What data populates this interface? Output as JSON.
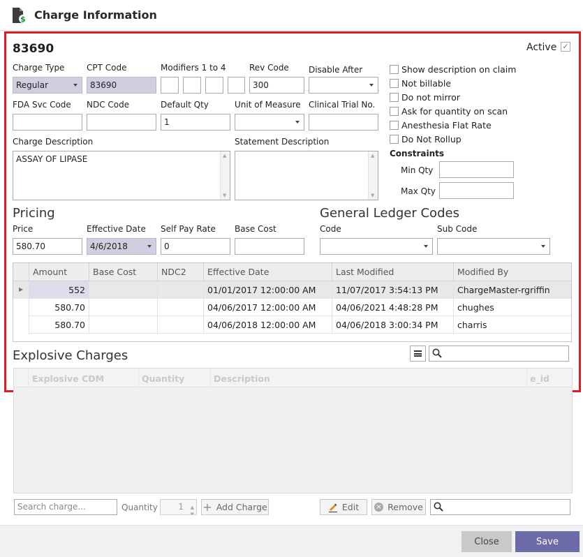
{
  "window": {
    "title": "Charge Information"
  },
  "header": {
    "code": "83690",
    "active_label": "Active"
  },
  "fields": {
    "charge_type": {
      "label": "Charge Type",
      "value": "Regular"
    },
    "cpt_code": {
      "label": "CPT Code",
      "value": "83690"
    },
    "modifiers": {
      "label": "Modifiers 1 to 4"
    },
    "rev_code": {
      "label": "Rev Code",
      "value": "300"
    },
    "disable_after": {
      "label": "Disable After",
      "value": ""
    },
    "fda_svc_code": {
      "label": "FDA Svc Code",
      "value": ""
    },
    "ndc_code": {
      "label": "NDC Code",
      "value": ""
    },
    "default_qty": {
      "label": "Default Qty",
      "value": "1"
    },
    "unit_of_measure": {
      "label": "Unit of Measure",
      "value": ""
    },
    "clinical_trial_no": {
      "label": "Clinical Trial No.",
      "value": ""
    },
    "charge_description": {
      "label": "Charge Description",
      "value": "ASSAY OF LIPASE"
    },
    "statement_description": {
      "label": "Statement Description",
      "value": ""
    }
  },
  "checkboxes": [
    {
      "label": "Show description on claim",
      "checked": false
    },
    {
      "label": "Not billable",
      "checked": false
    },
    {
      "label": "Do not mirror",
      "checked": false
    },
    {
      "label": "Ask for quantity on scan",
      "checked": false
    },
    {
      "label": "Anesthesia Flat Rate",
      "checked": false
    },
    {
      "label": "Do Not Rollup",
      "checked": false
    }
  ],
  "constraints": {
    "title": "Constraints",
    "min_qty_label": "Min Qty",
    "max_qty_label": "Max Qty",
    "min_qty": "",
    "max_qty": ""
  },
  "pricing": {
    "title": "Pricing",
    "price_label": "Price",
    "price": "580.70",
    "effective_date_label": "Effective Date",
    "effective_date": "4/6/2018",
    "self_pay_rate_label": "Self Pay Rate",
    "self_pay_rate": "0",
    "base_cost_label": "Base Cost",
    "base_cost": ""
  },
  "gl": {
    "title": "General Ledger Codes",
    "code_label": "Code",
    "sub_code_label": "Sub Code"
  },
  "price_grid": {
    "columns": [
      "Amount",
      "Base Cost",
      "NDC2",
      "Effective Date",
      "Last Modified",
      "Modified By"
    ],
    "rows": [
      [
        "552",
        "",
        "",
        "01/01/2017 12:00:00 AM",
        "11/07/2017 3:54:13 PM",
        "ChargeMaster-rgriffin"
      ],
      [
        "580.70",
        "",
        "",
        "04/06/2017 12:00:00 AM",
        "04/06/2021 4:48:28 PM",
        "chughes"
      ],
      [
        "580.70",
        "",
        "",
        "04/06/2018 12:00:00 AM",
        "04/06/2018 3:00:34 PM",
        "charris"
      ]
    ]
  },
  "explosive": {
    "title": "Explosive Charges",
    "columns": [
      "Explosive CDM",
      "Quantity",
      "Description",
      "e_id"
    ]
  },
  "bottom_bar": {
    "search_placeholder": "Search charge...",
    "quantity_label": "Quantity",
    "quantity_value": "1",
    "add_charge": "Add Charge",
    "edit": "Edit",
    "remove": "Remove"
  },
  "footer": {
    "close": "Close",
    "save": "Save"
  },
  "colors": {
    "highlight": "#e01b24",
    "save_bg": "#6d6aa8",
    "readonly_bg": "#cfcfe0"
  }
}
